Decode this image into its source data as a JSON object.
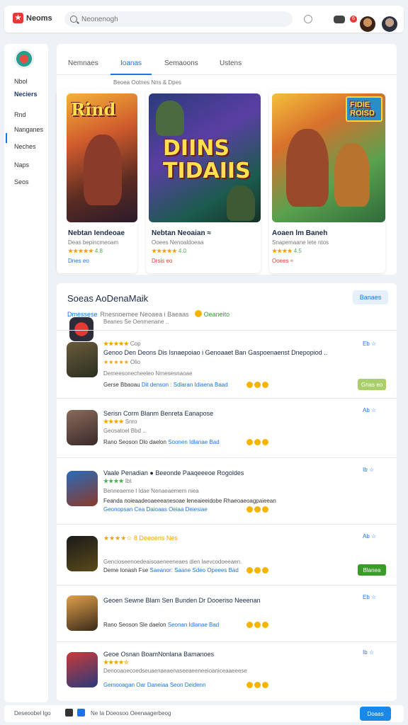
{
  "topbar": {
    "brand": "Neoms",
    "search_placeholder": "Neonenogh"
  },
  "sidebar": {
    "items": [
      "Nbol",
      "Neciers",
      "Rnd",
      "Nanganes",
      "Neches",
      "Naps",
      "Seos"
    ]
  },
  "featured": {
    "tabs": [
      "Nemnaes",
      "Ioanas",
      "Semaoons",
      "Ustens"
    ],
    "subtitle": "Beoea Ootnes Nns & Dpes",
    "cards": [
      {
        "art_title": "Rind",
        "title": "Nebtan Iendeoae",
        "sub": "Deas bepincmeoam",
        "stars": "★★★★★",
        "rating": "4.8",
        "price": "Dnes eo"
      },
      {
        "art_title": "DIINS TIDAIIS",
        "title": "Nebtan Neoaian ≈",
        "sub": "Ooees Nenoaldoeaa",
        "stars": "★★★★★",
        "rating": "4.0",
        "price": "Drsis eo"
      },
      {
        "art_title": "FIDIE ROISD",
        "title": "Aoaen lm Baneh",
        "sub": "Snapemaane lete ntos",
        "stars": "★★★★",
        "rating": "4.5",
        "price": "Ooees ≈"
      }
    ]
  },
  "list": {
    "title": "Soeas AoDenaMaik",
    "button": "Banaes",
    "header_blue": "Dmessese",
    "header_gray": "Rnesnoemee Neoaea i Baeaas",
    "header_green": "Oeaneito",
    "header_sub": "Beanes Se Oenmenane ..",
    "rows": [
      {
        "title": "Genoo Den Deons Dis Isnaepoiao i Genoaaet Ban Gaspoenaenst Dnepopiod ..",
        "stars": "★★★★★",
        "rating": "Cop",
        "desc": "Demeesonecheeleo Nrnesesnaoae",
        "links_plain": "Gerse Bbaoau",
        "links_blue": "Dit denson : Sdlaran Idiaena Baad",
        "meta": "Eb ☆",
        "action": "Gnas eo"
      },
      {
        "title": "Serisn Corm Blanm Benreta  Eanapose",
        "stars": "★★★★",
        "rating": "Snro",
        "desc": "Geosatoel Bbd ..",
        "links_plain": "Rano Seoson  Dlo daelon",
        "links_blue": "Soonen Idlanae Bad",
        "meta": "Ab ☆"
      },
      {
        "title": "Vaale Penadian  ● Beeonde  Paaqeeeoe Rogoldes",
        "stars": "★★★★",
        "rating": "Ibt",
        "desc": "Benneaeme l Idae Nenaeaemem niea",
        "links_plain": "Feanda noieaadeoaeeeanesoae leneaieeidobe Rhaeoaeoagpaieean",
        "links_blue": "Geonopsan Cea Daioaas Oeiaa Deiesiae",
        "meta": "Ib ☆"
      },
      {
        "title": "★★★★☆ 8 Deeoens  Nes",
        "stars": "",
        "rating": "",
        "desc": "Gencioseenoedeaisoaeneeneaes dien laevcodoeeaen.",
        "links_plain": "Deme Ionash  Fse",
        "links_blue": "Saeanor: Saane Sdeo Opeees Bad",
        "meta": "Ab ☆",
        "action": "Blanea"
      },
      {
        "title": "Geoen Sewne Blam Sen Bunden  Dr Dooeriso Neeenan",
        "stars": "",
        "rating": "",
        "desc": "",
        "links_plain": "Rano Seoson  Sle daelon",
        "links_blue": "Seonan Idlanae Bad",
        "meta": "Eb ☆"
      },
      {
        "title": "Geoe Osnan BoamNonlana  Bamanoes",
        "stars": "★★★★☆",
        "rating": "",
        "desc": "Denooaoecoedseuaenaeaenaseeaeeneeioaniceaaeeese",
        "links_plain": "",
        "links_blue": "Gemooagan Oar Daneiaa Seon Deidenn",
        "meta": "Ib ☆"
      }
    ]
  },
  "footer": {
    "left": "Deseoobel Igo",
    "mid": "Ne Ia Doeosoo Oeenaagerbeog",
    "button": "Doaas"
  }
}
